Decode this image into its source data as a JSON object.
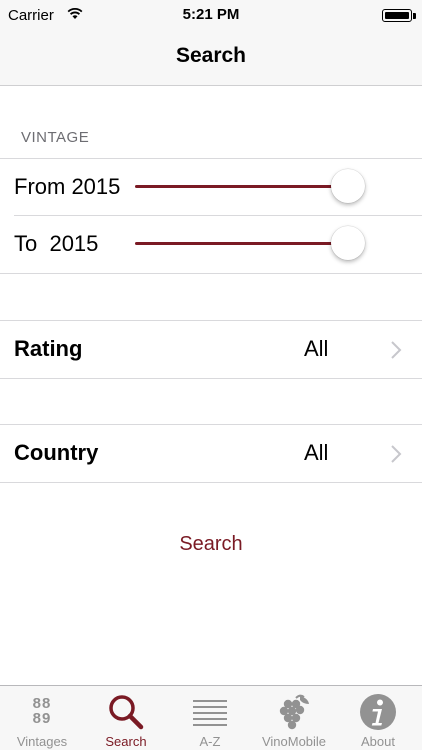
{
  "status_bar": {
    "carrier": "Carrier",
    "time": "5:21 PM"
  },
  "nav": {
    "title": "Search"
  },
  "vintage": {
    "header": "VINTAGE",
    "from_label": "From 2015",
    "to_label": "To  2015"
  },
  "rows": [
    {
      "label": "Rating",
      "value": "All"
    },
    {
      "label": "Country",
      "value": "All"
    }
  ],
  "search_button": "Search",
  "tabs": [
    {
      "label": "Vintages",
      "icon": "vintages-8889-icon",
      "digits_top": "88",
      "digits_bottom": "89"
    },
    {
      "label": "Search",
      "icon": "search-icon",
      "active": true
    },
    {
      "label": "A-Z",
      "icon": "list-icon"
    },
    {
      "label": "VinoMobile",
      "icon": "grapes-icon"
    },
    {
      "label": "About",
      "icon": "info-icon"
    }
  ],
  "colors": {
    "accent": "#7a1a24",
    "inactive_tab": "#929292",
    "bar_background": "#f7f7f7"
  }
}
